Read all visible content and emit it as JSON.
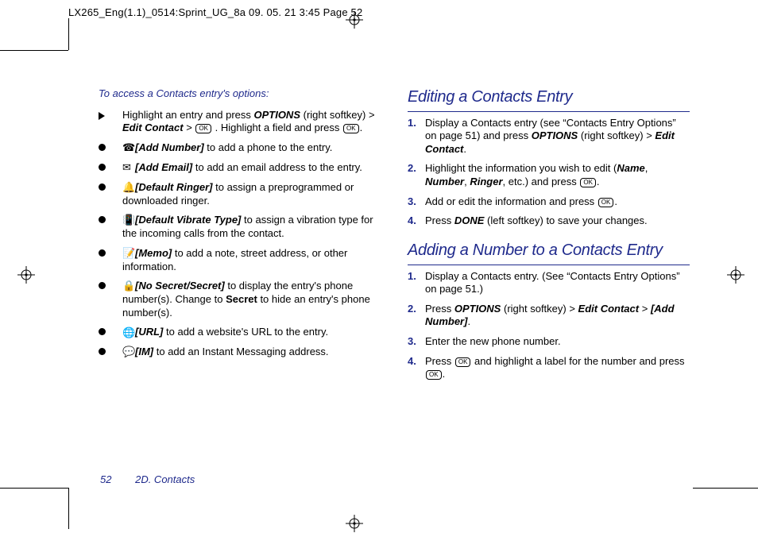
{
  "meta": {
    "header": "LX265_Eng(1.1)_0514:Sprint_UG_8a  09. 05. 21    3:45  Page 52"
  },
  "left": {
    "intro": "To access a Contacts entry's options:",
    "main": {
      "t1": "Highlight an entry and press ",
      "options": "OPTIONS",
      "t2": " (right softkey) > ",
      "edit": "Edit Contact",
      "t3": " > ",
      "t4": ". Highlight a field and press "
    },
    "items": [
      {
        "label": "[Add Number]",
        "text": " to add a phone to the entry."
      },
      {
        "label": "[Add Email]",
        "text": " to add an email address to the entry."
      },
      {
        "label": "[Default Ringer]",
        "text": " to assign a preprogrammed or downloaded ringer."
      },
      {
        "label": "[Default Vibrate Type]",
        "text": " to assign a vibration type for the incoming calls from the contact."
      },
      {
        "label": "[Memo]",
        "text": " to add a note, street address, or other information."
      },
      {
        "label": "[No Secret/Secret]",
        "t1": " to display the entry's phone number(s). Change to ",
        "secret": "Secret",
        "t2": " to hide an entry's phone number(s)."
      },
      {
        "label": "[URL]",
        "text": " to add a website's URL to the entry."
      },
      {
        "label": "[IM]",
        "text": " to add an Instant Messaging address."
      }
    ]
  },
  "right": {
    "section1": {
      "title": "Editing a Contacts Entry",
      "steps": [
        {
          "t1": "Display a Contacts entry (see “Contacts Entry Options” on page 51) and press ",
          "options": "OPTIONS",
          "t2": " (right softkey) > ",
          "edit": "Edit Contact"
        },
        {
          "t1": "Highlight the information you wish to edit (",
          "name": "Name",
          "number": "Number",
          "ringer": "Ringer",
          "t2": ", etc.) and press "
        },
        {
          "t1": "Add or edit the information and press "
        },
        {
          "t1": "Press ",
          "done": "DONE",
          "t2": " (left softkey) to save your changes."
        }
      ]
    },
    "section2": {
      "title": "Adding a Number to a Contacts Entry",
      "steps": [
        {
          "text": "Display a Contacts entry. (See “Contacts Entry Options” on page 51.)"
        },
        {
          "t1": "Press ",
          "options": "OPTIONS",
          "t2": " (right softkey) > ",
          "edit": "Edit Contact",
          "t3": " > ",
          "add": "[Add Number]"
        },
        {
          "text": "Enter the new phone number."
        },
        {
          "t1": "Press ",
          "t2": " and highlight a label for the number and press "
        }
      ]
    }
  },
  "footer": {
    "page": "52",
    "section": "2D. Contacts"
  }
}
